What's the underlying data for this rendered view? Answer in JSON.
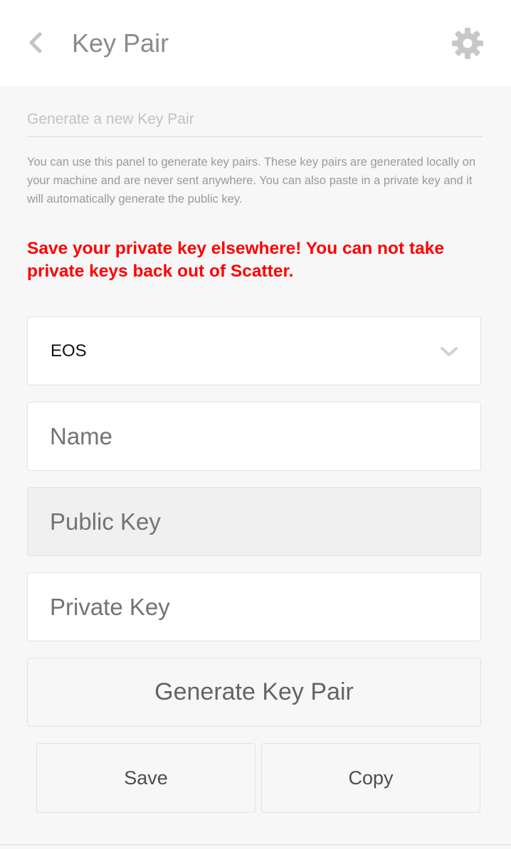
{
  "header": {
    "title": "Key Pair",
    "back_icon": "chevron-left-icon",
    "settings_icon": "gear-icon"
  },
  "section": {
    "title": "Generate a new Key Pair",
    "description": "You can use this panel to generate key pairs. These key pairs are generated locally on your machine and are never sent anywhere. You can also paste in a private key and it will automatically generate the public key.",
    "warning": "Save your private key elsewhere! You can not take private keys back out of Scatter."
  },
  "form": {
    "blockchain_selected": "EOS",
    "name_placeholder": "Name",
    "public_key_placeholder": "Public Key",
    "private_key_placeholder": "Private Key"
  },
  "buttons": {
    "generate": "Generate Key Pair",
    "save": "Save",
    "copy": "Copy"
  },
  "colors": {
    "warning": "#ff0000",
    "background": "#f7f7f7",
    "header_background": "#ffffff"
  }
}
